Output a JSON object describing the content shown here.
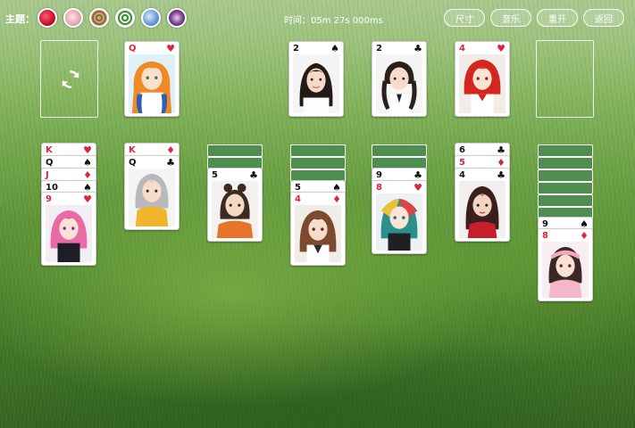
{
  "topbar": {
    "theme_label": "主题：",
    "timer": "时间：05m 27s 000ms",
    "buttons": {
      "size": "尺寸",
      "music": "音乐",
      "restart": "重开",
      "back": "返回"
    }
  },
  "themes": [
    {
      "name": "rose",
      "color": "#c8102e"
    },
    {
      "name": "pink-floral",
      "color": "#e9a9b6"
    },
    {
      "name": "wood",
      "color": "#a9895e"
    },
    {
      "name": "green-rings",
      "color": "#3f8f3f"
    },
    {
      "name": "blue-sky",
      "color": "#6a9ed6"
    },
    {
      "name": "purple-flower",
      "color": "#7a3d8f"
    }
  ],
  "icons": {
    "stock": "refresh-icon"
  },
  "cards": {
    "waste": {
      "rank": "Q",
      "suit": "♥"
    },
    "foundations": [
      {
        "rank": "2",
        "suit": "♠"
      },
      {
        "rank": "2",
        "suit": "♣"
      },
      {
        "rank": "4",
        "suit": "♥"
      }
    ],
    "col1": [
      {
        "rank": "K",
        "suit": "♥"
      },
      {
        "rank": "Q",
        "suit": "♠"
      },
      {
        "rank": "J",
        "suit": "♦"
      },
      {
        "rank": "10",
        "suit": "♠"
      },
      {
        "rank": "9",
        "suit": "♥"
      }
    ],
    "col2": [
      {
        "rank": "K",
        "suit": "♦"
      },
      {
        "rank": "Q",
        "suit": "♣"
      }
    ],
    "col3": [
      {
        "rank": "5",
        "suit": "♣"
      }
    ],
    "col4": [
      {
        "rank": "5",
        "suit": "♠"
      },
      {
        "rank": "4",
        "suit": "♦"
      }
    ],
    "col5": [
      {
        "rank": "9",
        "suit": "♣"
      },
      {
        "rank": "8",
        "suit": "♥"
      }
    ],
    "col6": [
      {
        "rank": "6",
        "suit": "♣"
      },
      {
        "rank": "5",
        "suit": "♦"
      },
      {
        "rank": "4",
        "suit": "♣"
      }
    ],
    "col7": [
      {
        "rank": "9",
        "suit": "♠"
      },
      {
        "rank": "8",
        "suit": "♦"
      }
    ]
  },
  "colors": {
    "accent_red": "#d7263d",
    "card_back": "#4e8f50"
  }
}
